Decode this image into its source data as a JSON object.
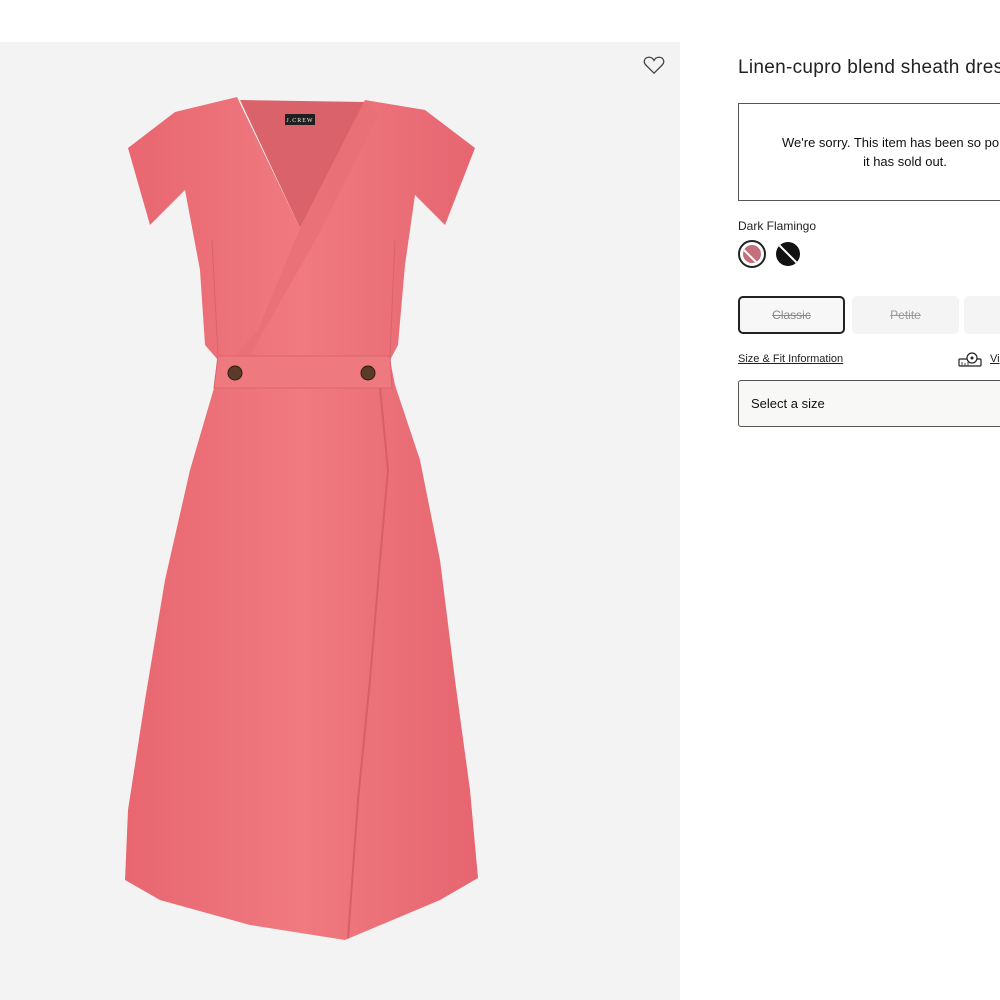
{
  "product": {
    "title": "Linen-cupro blend sheath dress",
    "brand_label": "J.CREW"
  },
  "image": {
    "heart_icon": "heart-outline-icon",
    "dress_color": "#eb7178"
  },
  "soldout": {
    "line1": "We're sorry. This item has been so popular",
    "line2": "it has sold out."
  },
  "color": {
    "selected_name": "Dark Flamingo",
    "swatches": [
      {
        "name": "Dark Flamingo",
        "hex": "#c4707c",
        "selected": true
      },
      {
        "name": "black",
        "hex": "#121212",
        "selected": false
      }
    ]
  },
  "fit": {
    "options": [
      "Classic",
      "Petite",
      ""
    ]
  },
  "links": {
    "size_fit": "Size & Fit Information",
    "view": "Vi"
  },
  "size_select": {
    "placeholder": "Select a size"
  }
}
